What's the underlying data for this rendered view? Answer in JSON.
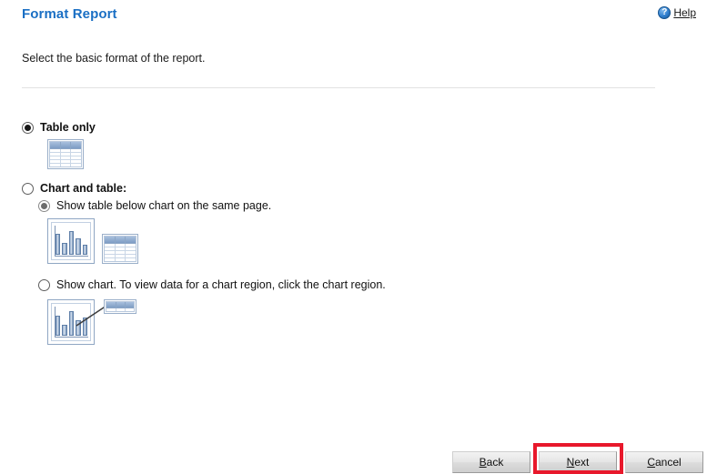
{
  "header": {
    "title": "Format Report",
    "help_label": "Help",
    "help_icon": "help-question-circle-icon"
  },
  "instruction": "Select the basic format of the report.",
  "options": {
    "table_only": {
      "label": "Table only",
      "selected": true,
      "icon": "table-icon"
    },
    "chart_and_table": {
      "label": "Chart and table:",
      "selected": false,
      "sub_options": [
        {
          "label": "Show table below chart on the same page.",
          "selected": true,
          "icon": "bar-chart-and-table-icon"
        },
        {
          "label": "Show chart. To view data for a chart region, click the chart region.",
          "selected": false,
          "icon": "bar-chart-with-tooltip-table-icon"
        }
      ]
    }
  },
  "footer": {
    "back": {
      "mnemonic": "B",
      "rest": "ack"
    },
    "next": {
      "mnemonic": "N",
      "rest": "ext"
    },
    "cancel": {
      "mnemonic": "C",
      "rest": "ancel"
    }
  },
  "annotation": {
    "highlight_target": "next-button",
    "highlight_color": "#e8182b"
  },
  "colors": {
    "title_blue": "#1a6fc4",
    "divider": "#e2e2e2",
    "icon_blue": "#7e9dc4"
  }
}
